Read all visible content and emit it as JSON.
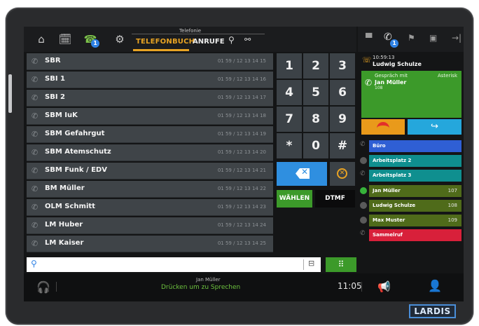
{
  "topbar": {
    "section_title": "Telefonie",
    "tab_phonebook": "TELEFONBUCH",
    "tab_calls": "ANRUFE",
    "phonebook_badge": "1"
  },
  "right_topbar": {
    "calls_badge": "1"
  },
  "contacts": [
    {
      "name": "SBR",
      "number": "01 59 / 12 13 14 15"
    },
    {
      "name": "SBI 1",
      "number": "01 59 / 12 13 14 16"
    },
    {
      "name": "SBI 2",
      "number": "01 59 / 12 13 14 17"
    },
    {
      "name": "SBM IuK",
      "number": "01 59 / 12 13 14 18"
    },
    {
      "name": "SBM Gefahrgut",
      "number": "01 59 / 12 13 14 19"
    },
    {
      "name": "SBM Atemschutz",
      "number": "01 59 / 12 13 14 20"
    },
    {
      "name": "SBM Funk / EDV",
      "number": "01 59 / 12 13 14 21"
    },
    {
      "name": "BM Müller",
      "number": "01 59 / 12 13 14 22"
    },
    {
      "name": "OLM Schmitt",
      "number": "01 59 / 12 13 14 23"
    },
    {
      "name": "LM Huber",
      "number": "01 59 / 12 13 14 24"
    },
    {
      "name": "LM Kaiser",
      "number": "01 59 / 12 13 14 25"
    }
  ],
  "keypad": {
    "keys": [
      "1",
      "2",
      "3",
      "4",
      "5",
      "6",
      "7",
      "8",
      "9",
      "*",
      "0",
      "#"
    ],
    "dial_label": "WÄHLEN",
    "dtmf_label": "DTMF"
  },
  "search": {
    "placeholder": ""
  },
  "missed_call": {
    "time": "10:59:13",
    "name": "Ludwig Schulze"
  },
  "active_call": {
    "label": "Gespräch mit",
    "server": "Asterisk",
    "name": "Jan Müller",
    "number": "108"
  },
  "lines": [
    {
      "name": "Büro",
      "ext": "",
      "color": "#2f5fd4",
      "indicator": "phone"
    },
    {
      "name": "Arbeitsplatz 2",
      "ext": "",
      "color": "#0f8f8f",
      "indicator": "grey"
    },
    {
      "name": "Arbeitsplatz 3",
      "ext": "",
      "color": "#0f8f8f",
      "indicator": "phone"
    },
    {
      "name": "Jan Müller",
      "ext": "107",
      "color": "#4f6b1a",
      "indicator": "green"
    },
    {
      "name": "Ludwig Schulze",
      "ext": "108",
      "color": "#4f6b1a",
      "indicator": "grey"
    },
    {
      "name": "Max Muster",
      "ext": "109",
      "color": "#4f6b1a",
      "indicator": "grey"
    },
    {
      "name": "Sammelruf",
      "ext": "",
      "color": "#d8203a",
      "indicator": "phone"
    }
  ],
  "bottombar": {
    "caller": "Jan Müller",
    "ptt_text": "Drücken um zu Sprechen",
    "time": "11:05"
  },
  "brand": "LARDIS"
}
